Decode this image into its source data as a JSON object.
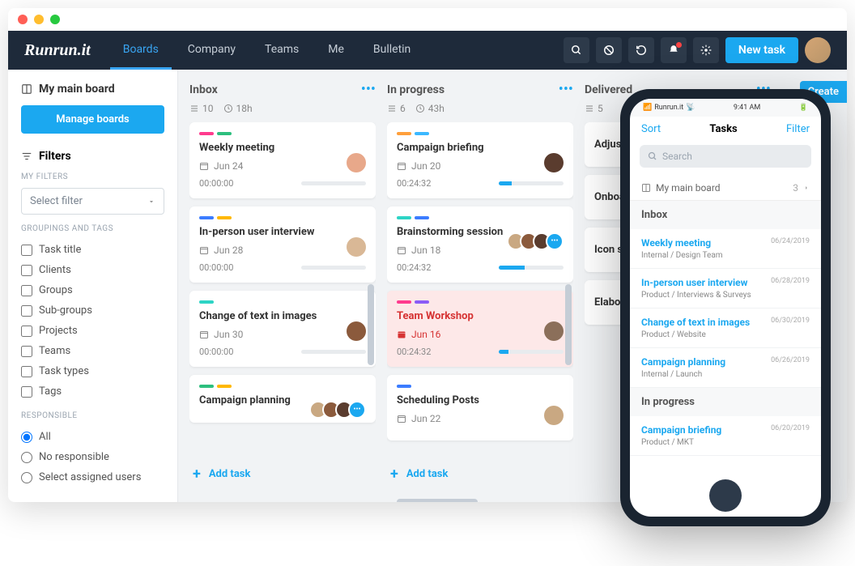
{
  "logo": "Runrun.it",
  "nav": [
    "Boards",
    "Company",
    "Teams",
    "Me",
    "Bulletin"
  ],
  "new_task": "New task",
  "create": "Create",
  "sidebar": {
    "board": "My main board",
    "manage": "Manage boards",
    "filters": "Filters",
    "my_filters": "MY FILTERS",
    "select_filter": "Select filter",
    "groupings": "GROUPINGS AND TAGS",
    "checks": [
      "Task title",
      "Clients",
      "Groups",
      "Sub-groups",
      "Projects",
      "Teams",
      "Task types",
      "Tags"
    ],
    "responsible": "RESPONSIBLE",
    "radios": [
      "All",
      "No responsible",
      "Select assigned users"
    ]
  },
  "columns": [
    {
      "title": "Inbox",
      "count": "10",
      "hours": "18h",
      "add": "Add task",
      "cards": [
        {
          "tags": [
            "#ff3b8e",
            "#2dbf7e"
          ],
          "title": "Weekly meeting",
          "date": "Jun 24",
          "timer": "00:00:00",
          "progress": 0,
          "av": "#e8a88a"
        },
        {
          "tags": [
            "#3b7cff",
            "#ffb800"
          ],
          "title": "In-person user interview",
          "date": "Jun 28",
          "timer": "00:00:00",
          "progress": 0,
          "av": "#d9b896"
        },
        {
          "tags": [
            "#2dd4c5"
          ],
          "title": "Change of text in images",
          "date": "Jun 30",
          "timer": "00:00:00",
          "progress": 0,
          "av": "#8b5a3c"
        },
        {
          "tags": [
            "#2dbf7e",
            "#ffb800"
          ],
          "title": "Campaign planning",
          "date": "",
          "timer": "",
          "progress": 0,
          "stack": true
        }
      ]
    },
    {
      "title": "In progress",
      "count": "6",
      "hours": "43h",
      "add": "Add task",
      "cards": [
        {
          "tags": [
            "#ff9f3b",
            "#3bb8ff"
          ],
          "title": "Campaign briefing",
          "date": "Jun 20",
          "timer": "00:24:32",
          "progress": 20,
          "av": "#5a3c2e"
        },
        {
          "tags": [
            "#2dd4c5",
            "#3b7cff"
          ],
          "title": "Brainstorming session",
          "date": "Jun 18",
          "timer": "00:24:32",
          "progress": 40,
          "stack": true
        },
        {
          "tags": [
            "#ff3b8e",
            "#8b5cf6"
          ],
          "title": "Team Workshop",
          "date": "Jun 16",
          "timer": "00:24:32",
          "progress": 15,
          "red": true,
          "av": "#8b6f5a"
        },
        {
          "tags": [
            "#3b7cff"
          ],
          "title": "Scheduling Posts",
          "date": "Jun 22",
          "timer": "",
          "progress": 0,
          "av": "#c9a882"
        }
      ]
    },
    {
      "title": "Delivered",
      "count": "5",
      "hours": "",
      "add": "",
      "cards": [
        {
          "tags": [],
          "title": "Adjust Spacing",
          "date": "",
          "timer": "",
          "progress": 0
        },
        {
          "tags": [],
          "title": "Onboarding",
          "date": "",
          "timer": "",
          "progress": 0
        },
        {
          "tags": [],
          "title": "Icon set",
          "date": "",
          "timer": "",
          "progress": 0
        },
        {
          "tags": [],
          "title": "Elaborate",
          "date": "",
          "timer": "",
          "progress": 0
        }
      ]
    }
  ],
  "phone": {
    "carrier": "Runrun.it",
    "time": "9:41 AM",
    "sort": "Sort",
    "title": "Tasks",
    "filter": "Filter",
    "search": "Search",
    "board": "My main board",
    "board_count": "3",
    "sections": [
      {
        "name": "Inbox",
        "items": [
          {
            "title": "Weekly meeting",
            "sub": "Internal / Design Team",
            "date": "06/24/2019"
          },
          {
            "title": "In-person user interview",
            "sub": "Product / Interviews & Surveys",
            "date": "06/28/2019"
          },
          {
            "title": "Change of text in images",
            "sub": "Product / Website",
            "date": "06/30/2019"
          },
          {
            "title": "Campaign planning",
            "sub": "Internal / Launch",
            "date": "06/26/2019"
          }
        ]
      },
      {
        "name": "In progress",
        "items": [
          {
            "title": "Campaign briefing",
            "sub": "Product / MKT",
            "date": "06/20/2019"
          }
        ]
      }
    ]
  }
}
